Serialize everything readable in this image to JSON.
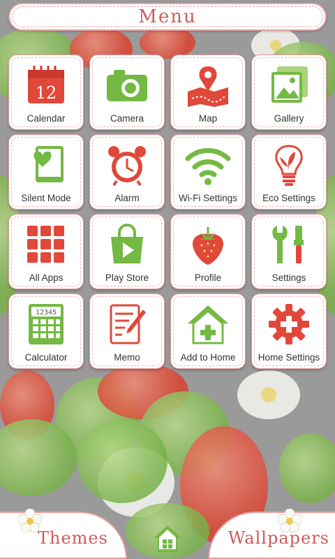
{
  "header": {
    "title": "Menu"
  },
  "apps": [
    {
      "label": "Calendar",
      "icon": "calendar-icon"
    },
    {
      "label": "Camera",
      "icon": "camera-icon"
    },
    {
      "label": "Map",
      "icon": "map-icon"
    },
    {
      "label": "Gallery",
      "icon": "gallery-icon"
    },
    {
      "label": "Silent Mode",
      "icon": "silent-mode-icon"
    },
    {
      "label": "Alarm",
      "icon": "alarm-clock-icon"
    },
    {
      "label": "Wi-Fi Settings",
      "icon": "wifi-icon"
    },
    {
      "label": "Eco Settings",
      "icon": "eco-bulb-icon"
    },
    {
      "label": "All Apps",
      "icon": "all-apps-grid-icon"
    },
    {
      "label": "Play Store",
      "icon": "play-store-icon"
    },
    {
      "label": "Profile",
      "icon": "strawberry-icon"
    },
    {
      "label": "Settings",
      "icon": "tools-icon"
    },
    {
      "label": "Calculator",
      "icon": "calculator-icon"
    },
    {
      "label": "Memo",
      "icon": "memo-icon"
    },
    {
      "label": "Add to Home",
      "icon": "add-home-icon"
    },
    {
      "label": "Home Settings",
      "icon": "gear-plus-icon"
    }
  ],
  "calendar_day": "12",
  "calculator_display": "12345",
  "footer": {
    "themes_label": "Themes",
    "wallpapers_label": "Wallpapers"
  },
  "colors": {
    "red": "#e0483a",
    "green": "#74b943",
    "border": "#e59b9b"
  }
}
